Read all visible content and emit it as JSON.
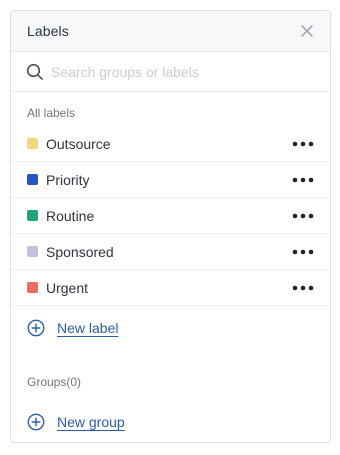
{
  "header": {
    "title": "Labels",
    "close_icon": "close-icon"
  },
  "search": {
    "placeholder": "Search groups or labels",
    "value": "",
    "icon": "search-icon"
  },
  "labels_section": {
    "title": "All labels",
    "items": [
      {
        "name": "Outsource",
        "color": "#f7d57a",
        "menu_icon": "more-horizontal-icon"
      },
      {
        "name": "Priority",
        "color": "#2256c6",
        "menu_icon": "more-horizontal-icon"
      },
      {
        "name": "Routine",
        "color": "#1ea57a",
        "menu_icon": "more-horizontal-icon"
      },
      {
        "name": "Sponsored",
        "color": "#c6c0e0",
        "menu_icon": "more-horizontal-icon"
      },
      {
        "name": "Urgent",
        "color": "#ef6a5f",
        "menu_icon": "more-horizontal-icon"
      }
    ],
    "new_label": "New label"
  },
  "groups_section": {
    "title": "Groups(0)",
    "new_group": "New group"
  },
  "colors": {
    "link": "#2b5cad",
    "text": "#2d3340",
    "muted": "#6f7682",
    "border": "#e6e8eb"
  }
}
